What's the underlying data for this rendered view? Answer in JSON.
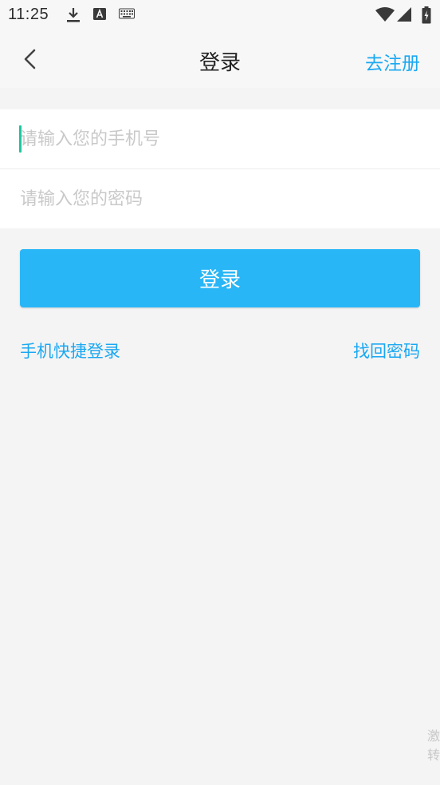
{
  "status_bar": {
    "time": "11:25",
    "icons": [
      "download-icon",
      "a-notification-icon",
      "keyboard-icon",
      "wifi-icon",
      "signal-icon",
      "battery-charging-icon"
    ]
  },
  "nav": {
    "back_icon": "chevron-left-icon",
    "title": "登录",
    "register_label": "去注册"
  },
  "form": {
    "phone_placeholder": "请输入您的手机号",
    "phone_value": "",
    "password_placeholder": "请输入您的密码",
    "password_value": ""
  },
  "login_button_label": "登录",
  "links": {
    "quick_login": "手机快捷登录",
    "forgot_password": "找回密码"
  },
  "watermark": {
    "line1": "激",
    "line2": "转"
  },
  "colors": {
    "accent": "#29b6f6",
    "link": "#1aa8f2",
    "cursor": "#1ec5a0",
    "background": "#f4f4f4"
  }
}
